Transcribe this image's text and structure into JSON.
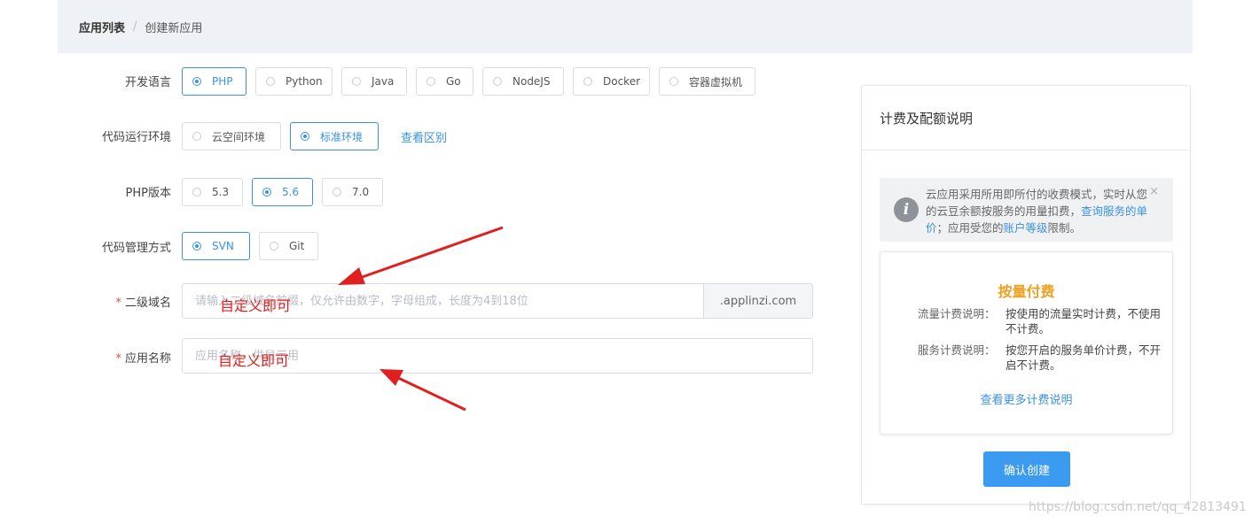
{
  "breadcrumb": {
    "root": "应用列表",
    "separator": "/",
    "current": "创建新应用"
  },
  "form": {
    "language": {
      "label": "开发语言",
      "options": [
        "PHP",
        "Python",
        "Java",
        "Go",
        "NodeJS",
        "Docker",
        "容器虚拟机"
      ],
      "selected": "PHP"
    },
    "runtime": {
      "label": "代码运行环境",
      "options": [
        "云空间环境",
        "标准环境"
      ],
      "selected": "标准环境",
      "link": "查看区别"
    },
    "php_version": {
      "label": "PHP版本",
      "options": [
        "5.3",
        "5.6",
        "7.0"
      ],
      "selected": "5.6"
    },
    "vcs": {
      "label": "代码管理方式",
      "options": [
        "SVN",
        "Git"
      ],
      "selected": "SVN"
    },
    "subdomain": {
      "required_mark": "*",
      "label": "二级域名",
      "placeholder": "请输入二级域名前缀，仅允许由数字，字母组成，长度为4到18位",
      "addon": ".applinzi.com",
      "annotation": "自定义即可"
    },
    "app_name": {
      "required_mark": "*",
      "label": "应用名称",
      "placeholder": "应用名称，供显示用",
      "annotation": "自定义即可"
    }
  },
  "panel": {
    "title": "计费及配额说明",
    "notice": {
      "text_1": "云应用采用所用即所付的收费模式，实时从您的云豆余额按服务的用量扣费，",
      "link_1": "查询服务的单价",
      "text_2": "；应用受您的",
      "link_2": "账户等级",
      "text_3": "限制。",
      "close": "×"
    },
    "plan": {
      "title": "按量付费",
      "traffic_key": "流量计费说明：",
      "traffic_val": "按使用的流量实时计费，不使用不计费。",
      "service_key": "服务计费说明：",
      "service_val": "按您开启的服务单价计费，不开启不计费。",
      "more_link": "查看更多计费说明"
    },
    "confirm_button": "确认创建"
  },
  "watermark": "https://blog.csdn.net/qq_42813491",
  "colors": {
    "accent": "#3a92e6",
    "plan_title": "#f0a020",
    "annotation": "#e02020",
    "required": "#e74c3c"
  }
}
